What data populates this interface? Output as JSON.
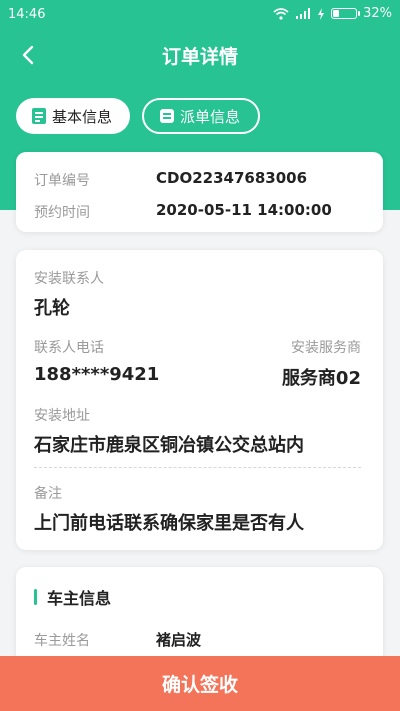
{
  "status_bar": {
    "time": "14:46",
    "battery": "32%",
    "battery_level": 0.32
  },
  "nav": {
    "title": "订单详情"
  },
  "tabs": [
    {
      "label": "基本信息",
      "active": true
    },
    {
      "label": "派单信息",
      "active": false
    }
  ],
  "order": {
    "number_label": "订单编号",
    "number_value": "CDO22347683006",
    "time_label": "预约时间",
    "time_value": "2020-05-11 14:00:00"
  },
  "install": {
    "contact_label": "安装联系人",
    "contact_value": "孔轮",
    "phone_label": "联系人电话",
    "phone_value": "188****9421",
    "provider_label": "安装服务商",
    "provider_value": "服务商02",
    "address_label": "安装地址",
    "address_value": "石家庄市鹿泉区铜冶镇公交总站内",
    "remark_label": "备注",
    "remark_value": "上门前电话联系确保家里是否有人"
  },
  "owner": {
    "section_title": "车主信息",
    "name_label": "车主姓名",
    "name_value": "褚启波"
  },
  "actions": {
    "confirm_label": "确认签收"
  },
  "colors": {
    "brand_green": "#27c392",
    "confirm_orange": "#f4745a"
  }
}
